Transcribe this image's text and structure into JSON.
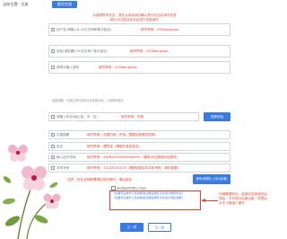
{
  "breadcrumb": {
    "home": "当前位置",
    "current": "注册"
  },
  "tab": {
    "label": "填写信息"
  },
  "notice": {
    "line1": "为保障账号安全，请在认真阅读并确认提示后如实填写信息",
    "line2": "确认在注册及实名后进行信息填写"
  },
  "fields": {
    "username": {
      "label": "用户名(请输入6-20位字母和数字组合)",
      "hint": "填写举例：233wangxiao"
    },
    "password": {
      "label": "密码(请设置6-20位字母+数字组合)",
      "hint": "填写举例：233Wangxiao"
    },
    "password_confirm": {
      "label": "请再次输入密码",
      "hint": "填写举例：233WangXiao"
    },
    "privacy_note": "温馨提醒：请保证您的身份信息准确无误，以便顺利报名",
    "address": {
      "label": "请输入所在地区(省、市、区)",
      "hint": "填写举例：东莞"
    },
    "address_button": "选择地址",
    "nationality": {
      "label": "中国国籍",
      "hint": "填写举例：中国内地（不选，根据自身情况选择）"
    },
    "name": {
      "label": "姓名",
      "hint": "填写举例：谭同成（请填写真实姓名）"
    },
    "id_number": {
      "label": "输入证件号码",
      "hint": "填写举例：430624199000000000（请按18位数身份证填写）"
    },
    "phone": {
      "label": "手机号码",
      "hint": "填写举例：13233233233（请提前核实本手机号码，请勿遗漏）"
    },
    "id_photo": {
      "hint": "注意：还在此例照理得包容识别时，请后放传",
      "button": "身份证照片上传(必填)"
    }
  },
  "agreement": {
    "checkbox_label": "我已阅读并同意以下协议",
    "links": [
      "《全国专业技术人员资格考试报名服务平台用户服务协议》",
      "《全国专业技术人员资格考试报名服务平台用户隐私政策》"
    ]
  },
  "side_note": "仔细看清协议，全部点击阅读协议项后，方可进行后续注册，同意后点击【继续】操作",
  "buttons": {
    "prev": "上一步",
    "next": "下一步"
  },
  "colors": {
    "accent": "#3a7be0",
    "hint": "#e53b2c"
  }
}
